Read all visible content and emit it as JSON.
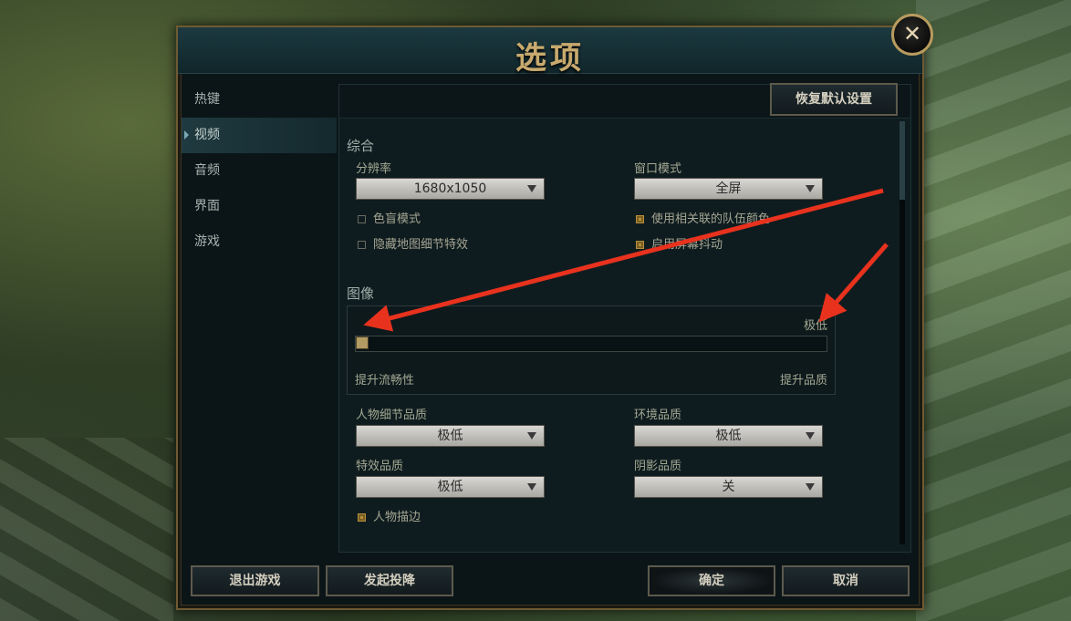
{
  "title": "选项",
  "close_glyph": "✕",
  "sidebar": {
    "items": [
      {
        "label": "热键"
      },
      {
        "label": "视频"
      },
      {
        "label": "音频"
      },
      {
        "label": "界面"
      },
      {
        "label": "游戏"
      }
    ]
  },
  "content": {
    "reset_button": "恢复默认设置",
    "general": {
      "title": "综合",
      "resolution_label": "分辨率",
      "resolution_value": "1680x1050",
      "window_mode_label": "窗口模式",
      "window_mode_value": "全屏",
      "checkboxes": [
        {
          "label": "色盲模式",
          "checked": false
        },
        {
          "label": "隐藏地图细节特效",
          "checked": false
        },
        {
          "label": "使用相关联的队伍颜色",
          "checked": true
        },
        {
          "label": "启用屏幕抖动",
          "checked": true
        }
      ]
    },
    "graphics": {
      "title": "图像",
      "quality_value": "极低",
      "slider_level": 0,
      "slider_left_label": "提升流畅性",
      "slider_right_label": "提升品质",
      "character_quality_label": "人物细节品质",
      "character_quality_value": "极低",
      "environment_quality_label": "环境品质",
      "environment_quality_value": "极低",
      "effects_quality_label": "特效品质",
      "effects_quality_value": "极低",
      "shadow_quality_label": "阴影品质",
      "shadow_quality_value": "关",
      "outline_label": "人物描边",
      "outline_checked": true
    }
  },
  "footer": {
    "exit": "退出游戏",
    "surrender": "发起投降",
    "ok": "确定",
    "cancel": "取消"
  },
  "colors": {
    "gold": "#c8aa6e",
    "annotation_arrow": "#e8321e"
  }
}
